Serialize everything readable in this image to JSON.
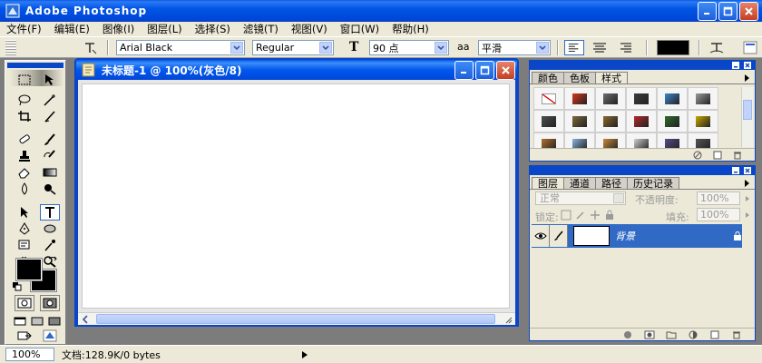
{
  "window": {
    "title": "Adobe Photoshop"
  },
  "menu": [
    "文件(F)",
    "编辑(E)",
    "图像(I)",
    "图层(L)",
    "选择(S)",
    "滤镜(T)",
    "视图(V)",
    "窗口(W)",
    "帮助(H)"
  ],
  "options": {
    "font_family": "Arial Black",
    "font_style": "Regular",
    "font_size": "90 点",
    "antialias_glyph": "aa",
    "antialias": "平滑",
    "size_glyph": "T"
  },
  "document": {
    "title": "未标题-1 @ 100%(灰色/8)"
  },
  "styles_panel": {
    "tabs": [
      "颜色",
      "色板",
      "样式"
    ],
    "swatches": [
      "#ffffff",
      "#d8361b",
      "#6c6c6c",
      "#3b3b3b",
      "#3a86c8",
      "#9a9a9a",
      "#4e4e4e",
      "#7d6a3a",
      "#8a6a2e",
      "#b52a2a",
      "#2f6b2b",
      "#c9a700",
      "#b07030",
      "#8ab4e0",
      "#c98a3a",
      "#d0d0d0",
      "#5a4a8a",
      "#555555"
    ]
  },
  "layers_panel": {
    "tabs": [
      "图层",
      "通道",
      "路径",
      "历史记录"
    ],
    "blend_mode": "正常",
    "opacity_label": "不透明度:",
    "opacity_value": "100%",
    "lock_label": "锁定:",
    "fill_label": "填充:",
    "fill_value": "100%",
    "layer_name": "背景"
  },
  "status": {
    "zoom": "100%",
    "doc_info": "文档:128.9K/0 bytes"
  },
  "colors": {
    "title_blue": "#0a46c8",
    "chrome": "#ece9d8",
    "selection": "#316ac5"
  }
}
